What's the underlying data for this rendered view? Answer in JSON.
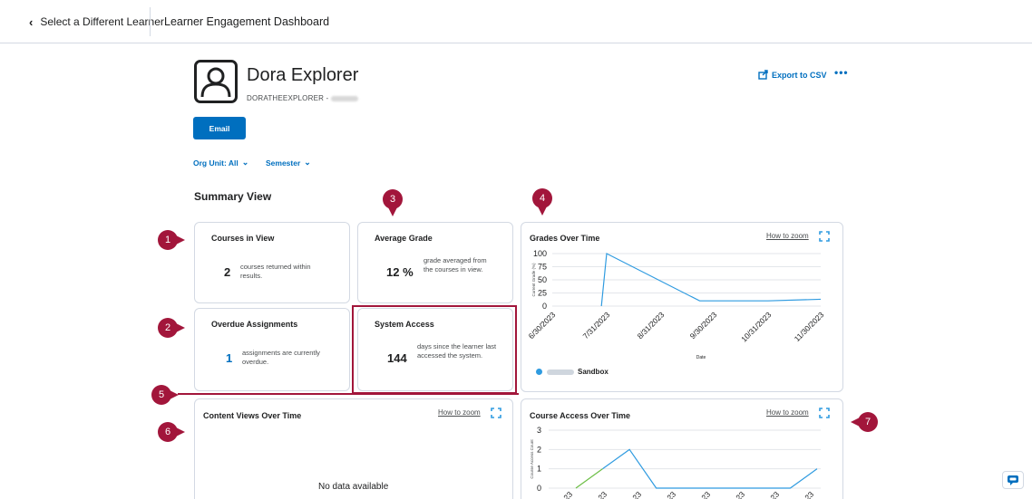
{
  "topbar": {
    "back_label": "Select a Different Learner",
    "title": "Learner Engagement Dashboard"
  },
  "learner": {
    "name": "Dora Explorer",
    "username": "DORATHEEXPLORER -"
  },
  "actions": {
    "export_label": "Export to CSV",
    "more_label": "•••",
    "email_label": "Email"
  },
  "filters": {
    "org_unit": "Org Unit: All",
    "semester": "Semester"
  },
  "summary_title": "Summary View",
  "cards": {
    "courses": {
      "title": "Courses in View",
      "value": "2",
      "desc": "courses returned within results."
    },
    "grade": {
      "title": "Average Grade",
      "value": "12 %",
      "desc": "grade averaged from the courses in view."
    },
    "overdue": {
      "title": "Overdue Assignments",
      "value": "1",
      "desc": "assignments are currently overdue."
    },
    "access": {
      "title": "System Access",
      "value": "144",
      "desc": "days since the learner last accessed the system."
    },
    "content_views": {
      "title": "Content Views Over Time",
      "zoom": "How to zoom",
      "empty": "No data available"
    }
  },
  "markers": [
    "1",
    "2",
    "3",
    "4",
    "5",
    "6",
    "7"
  ],
  "colors": {
    "accent": "#006fbf",
    "marker": "#a2163b",
    "line": "#2f9be0",
    "green": "#6cbe45"
  },
  "chart_data": [
    {
      "type": "line",
      "title": "Grades Over Time",
      "zoom": "How to zoom",
      "xlabel": "Date",
      "ylabel": "Current Grade (%)",
      "ylim": [
        0,
        100
      ],
      "yticks": [
        0,
        25,
        50,
        75,
        100
      ],
      "categories": [
        "6/30/2023",
        "7/31/2023",
        "8/31/2023",
        "9/30/2023",
        "10/31/2023",
        "11/30/2023"
      ],
      "series": [
        {
          "name": "Sandbox",
          "x": [
            "7/28/2023",
            "7/31/2023",
            "9/22/2023",
            "10/31/2023",
            "11/30/2023"
          ],
          "values": [
            0,
            100,
            10,
            10,
            13
          ]
        }
      ],
      "legend": "bottom-left"
    },
    {
      "type": "line",
      "title": "Course Access Over Time",
      "zoom": "How to zoom",
      "ylabel": "Course Access Count",
      "ylim": [
        0,
        3
      ],
      "yticks": [
        0,
        1,
        2,
        3
      ],
      "series": [
        {
          "values": [
            0,
            1,
            2,
            0,
            0,
            0,
            0,
            0,
            0,
            1
          ]
        }
      ]
    }
  ]
}
